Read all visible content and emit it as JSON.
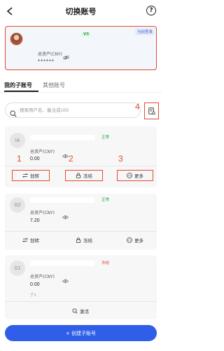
{
  "header": {
    "title": "切换账号"
  },
  "current": {
    "badge": "当前登录",
    "vip": "V3",
    "asset_label": "总资产(CNY)",
    "asset_value": "******"
  },
  "tabs": [
    {
      "label": "我的子账号",
      "active": true
    },
    {
      "label": "其他账号",
      "active": false
    }
  ],
  "search": {
    "placeholder": "搜索用户名、备注或UID"
  },
  "annotations": {
    "n1": "1",
    "n2": "2",
    "n3": "3",
    "n4": "4"
  },
  "accounts": [
    {
      "initials": "IA",
      "status": "正常",
      "asset_label": "总资产(CNY)",
      "asset_value": "0.00",
      "actions": [
        "划转",
        "冻结",
        "更多"
      ]
    },
    {
      "initials": "G2",
      "status": "正常",
      "asset_label": "总资产(CNY)",
      "asset_value": "7.20",
      "actions": [
        "划转",
        "冻结",
        "更多"
      ]
    },
    {
      "initials": "G1",
      "status": "冻结",
      "asset_label": "总资产(CNY)",
      "asset_value": "0.00",
      "note": "子1",
      "actions": [
        "激活"
      ]
    }
  ],
  "create_button": "+ 创建子账号",
  "colors": {
    "accent": "#2f5fe8",
    "annotation": "#e24b35",
    "normal": "#1aa34a",
    "frozen": "#e24b35"
  }
}
